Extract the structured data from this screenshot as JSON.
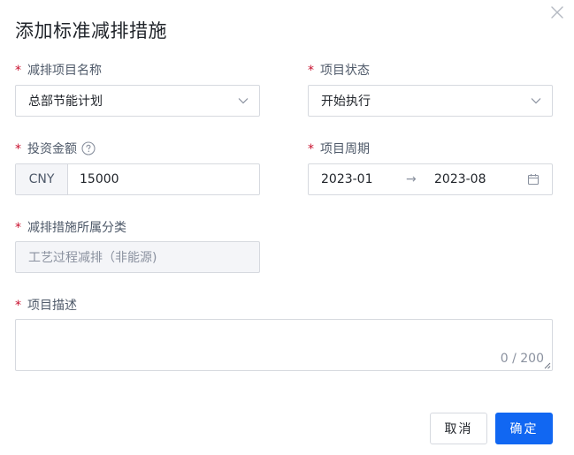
{
  "dialog": {
    "title": "添加标准减排措施",
    "close_icon": "close-icon"
  },
  "form": {
    "project_name": {
      "label": "减排项目名称",
      "required": true,
      "value": "总部节能计划"
    },
    "project_status": {
      "label": "项目状态",
      "required": true,
      "value": "开始执行"
    },
    "investment": {
      "label": "投资金额",
      "required": true,
      "currency": "CNY",
      "value": "15000",
      "help_icon": "question-circle-icon"
    },
    "project_period": {
      "label": "项目周期",
      "required": true,
      "start": "2023-01",
      "separator": "→",
      "end": "2023-08",
      "icon": "calendar-icon"
    },
    "category": {
      "label": "减排措施所属分类",
      "required": true,
      "value": "工艺过程减排（非能源)",
      "disabled": true
    },
    "description": {
      "label": "项目描述",
      "required": true,
      "value": "",
      "counter": "0 / 200"
    }
  },
  "footer": {
    "cancel_label": "取消",
    "ok_label": "确定"
  },
  "colors": {
    "primary": "#1167f2",
    "required": "#c8102e",
    "border": "#d6d9df",
    "disabled_bg": "#f4f5f8"
  }
}
